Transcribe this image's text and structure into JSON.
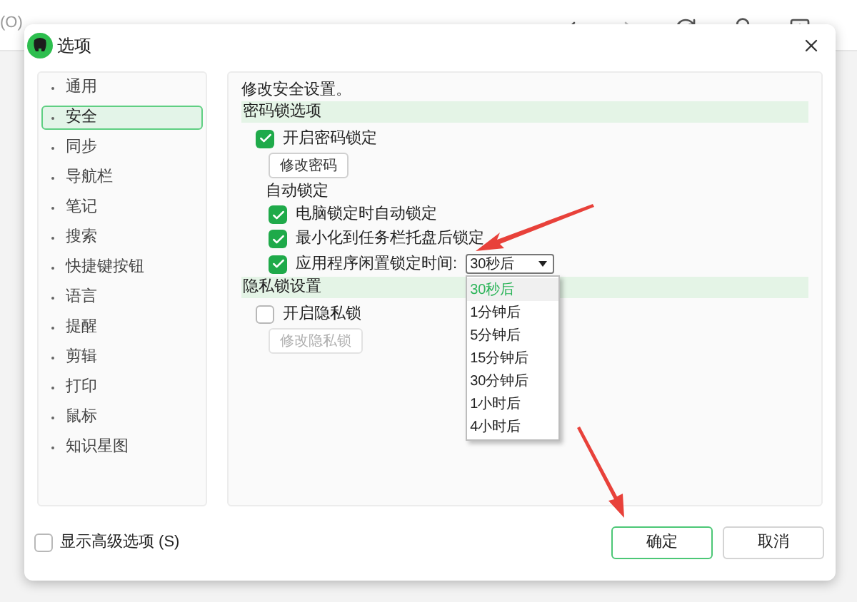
{
  "background_app": {
    "menu_fragment": "(O)"
  },
  "dialog": {
    "title": "选项"
  },
  "sidebar": {
    "items": [
      {
        "label": "通用",
        "selected": false
      },
      {
        "label": "安全",
        "selected": true
      },
      {
        "label": "同步",
        "selected": false
      },
      {
        "label": "导航栏",
        "selected": false
      },
      {
        "label": "笔记",
        "selected": false
      },
      {
        "label": "搜索",
        "selected": false
      },
      {
        "label": "快捷键按钮",
        "selected": false
      },
      {
        "label": "语言",
        "selected": false
      },
      {
        "label": "提醒",
        "selected": false
      },
      {
        "label": "剪辑",
        "selected": false
      },
      {
        "label": "打印",
        "selected": false
      },
      {
        "label": "鼠标",
        "selected": false
      },
      {
        "label": "知识星图",
        "selected": false
      }
    ]
  },
  "panel": {
    "description": "修改安全设置。",
    "sections": [
      {
        "title": "密码锁选项",
        "rows": [
          {
            "kind": "checkbox",
            "label": "开启密码锁定",
            "checked": true
          },
          {
            "kind": "button",
            "label": "修改密码",
            "disabled": false
          },
          {
            "kind": "subheading",
            "label": "自动锁定"
          },
          {
            "kind": "subcheckbox",
            "label": "电脑锁定时自动锁定",
            "checked": true
          },
          {
            "kind": "subcheckbox",
            "label": "最小化到任务栏托盘后锁定",
            "checked": true
          },
          {
            "kind": "subselect",
            "label": "应用程序闲置锁定时间:",
            "checked": true,
            "value": "30秒后",
            "expanded": true,
            "options": [
              {
                "label": "30秒后",
                "selected": true
              },
              {
                "label": "1分钟后",
                "selected": false
              },
              {
                "label": "5分钟后",
                "selected": false
              },
              {
                "label": "15分钟后",
                "selected": false
              },
              {
                "label": "30分钟后",
                "selected": false
              },
              {
                "label": "1小时后",
                "selected": false
              },
              {
                "label": "4小时后",
                "selected": false
              }
            ]
          }
        ]
      },
      {
        "title": "隐私锁设置",
        "rows": [
          {
            "kind": "checkbox",
            "label": "开启隐私锁",
            "checked": false
          },
          {
            "kind": "button",
            "label": "修改隐私锁",
            "disabled": true
          }
        ]
      }
    ]
  },
  "footer": {
    "advanced": {
      "label": "显示高级选项 (S)",
      "checked": false
    },
    "buttons": [
      {
        "label": "确定",
        "kind": "primary"
      },
      {
        "label": "取消",
        "kind": "secondary"
      }
    ]
  }
}
